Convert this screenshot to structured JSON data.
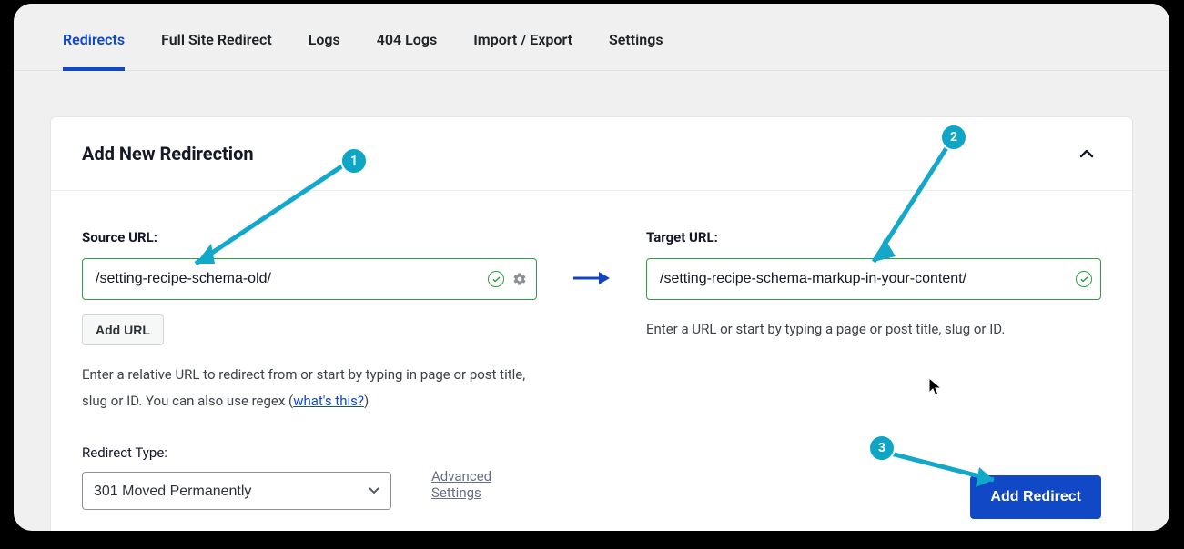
{
  "tabs": [
    "Redirects",
    "Full Site Redirect",
    "Logs",
    "404 Logs",
    "Import / Export",
    "Settings"
  ],
  "activeTab": 0,
  "card": {
    "title": "Add New Redirection"
  },
  "source": {
    "label": "Source URL:",
    "value": "/setting-recipe-schema-old/",
    "addUrl": "Add URL",
    "help_pre": "Enter a relative URL to redirect from or start by typing in page or post title, slug or ID. You can also use regex (",
    "help_link": "what's this?",
    "help_post": ")"
  },
  "target": {
    "label": "Target URL:",
    "value": "/setting-recipe-schema-markup-in-your-content/",
    "help": "Enter a URL or start by typing a page or post title, slug or ID."
  },
  "redirectType": {
    "label": "Redirect Type:",
    "value": "301 Moved Permanently"
  },
  "advanced": "Advanced Settings",
  "addRedirect": "Add Redirect",
  "annotations": [
    "1",
    "2",
    "3"
  ]
}
